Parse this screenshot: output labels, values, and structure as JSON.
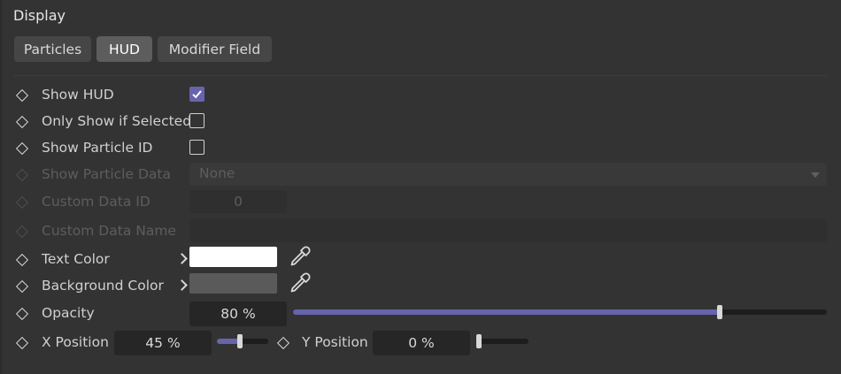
{
  "section": {
    "title": "Display"
  },
  "tabs": [
    {
      "label": "Particles",
      "active": false
    },
    {
      "label": "HUD",
      "active": true
    },
    {
      "label": "Modifier Field",
      "active": false
    }
  ],
  "fields": {
    "show_hud": {
      "label": "Show HUD",
      "checked": true
    },
    "only_show_if_selected": {
      "label": "Only Show if Selected",
      "checked": false
    },
    "show_particle_id": {
      "label": "Show Particle ID",
      "checked": false
    },
    "show_particle_data": {
      "label": "Show Particle Data",
      "value": "None",
      "enabled": false
    },
    "custom_data_id": {
      "label": "Custom Data ID",
      "value": "0",
      "enabled": false
    },
    "custom_data_name": {
      "label": "Custom Data Name",
      "value": "",
      "enabled": false
    },
    "text_color": {
      "label": "Text Color",
      "color": "#ffffff"
    },
    "background_color": {
      "label": "Background Color",
      "color": "#5a5a5a"
    },
    "opacity": {
      "label": "Opacity",
      "value": "80 %",
      "fraction": 0.8
    },
    "x_position": {
      "label": "X Position",
      "value": "45 %",
      "fraction": 0.45
    },
    "y_position": {
      "label": "Y Position",
      "value": "0 %",
      "fraction": 0.0
    }
  },
  "colors": {
    "accent": "#6764ad",
    "panel_bg": "#333333",
    "field_bg": "#262626"
  },
  "icons": {
    "keyframe": "diamond-icon",
    "expand": "chevron-right-icon",
    "color_picker": "eyedropper-icon",
    "check": "checkmark-icon",
    "dropdown": "triangle-down-icon"
  }
}
